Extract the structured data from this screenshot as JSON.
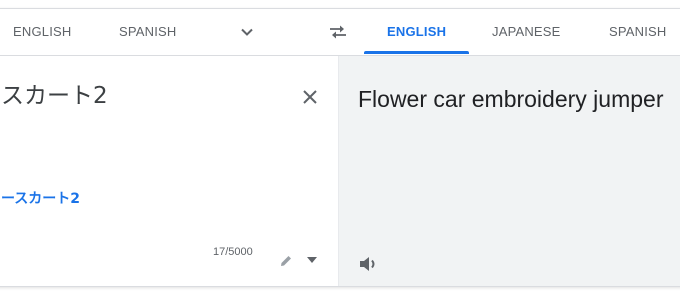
{
  "source_languages": {
    "tabs": [
      "ENGLISH",
      "SPANISH"
    ],
    "more_icon": "chevron-down-icon"
  },
  "swap_icon": "swap-arrows-icon",
  "target_languages": {
    "tabs": [
      "ENGLISH",
      "JAPANESE",
      "SPANISH"
    ],
    "selected": "ENGLISH"
  },
  "source": {
    "text": "スカート2",
    "transliteration": "ースカート2",
    "char_count": "17/5000",
    "clear_icon": "close-icon",
    "handwrite_icon": "pencil-icon",
    "input_tools_icon": "caret-down-icon"
  },
  "target": {
    "text": "Flower car embroidery jumper",
    "listen_icon": "speaker-icon"
  },
  "colors": {
    "accent": "#1a73e8",
    "target_background": "#f1f3f4",
    "text": "#3c4043",
    "muted": "#5f6368"
  }
}
